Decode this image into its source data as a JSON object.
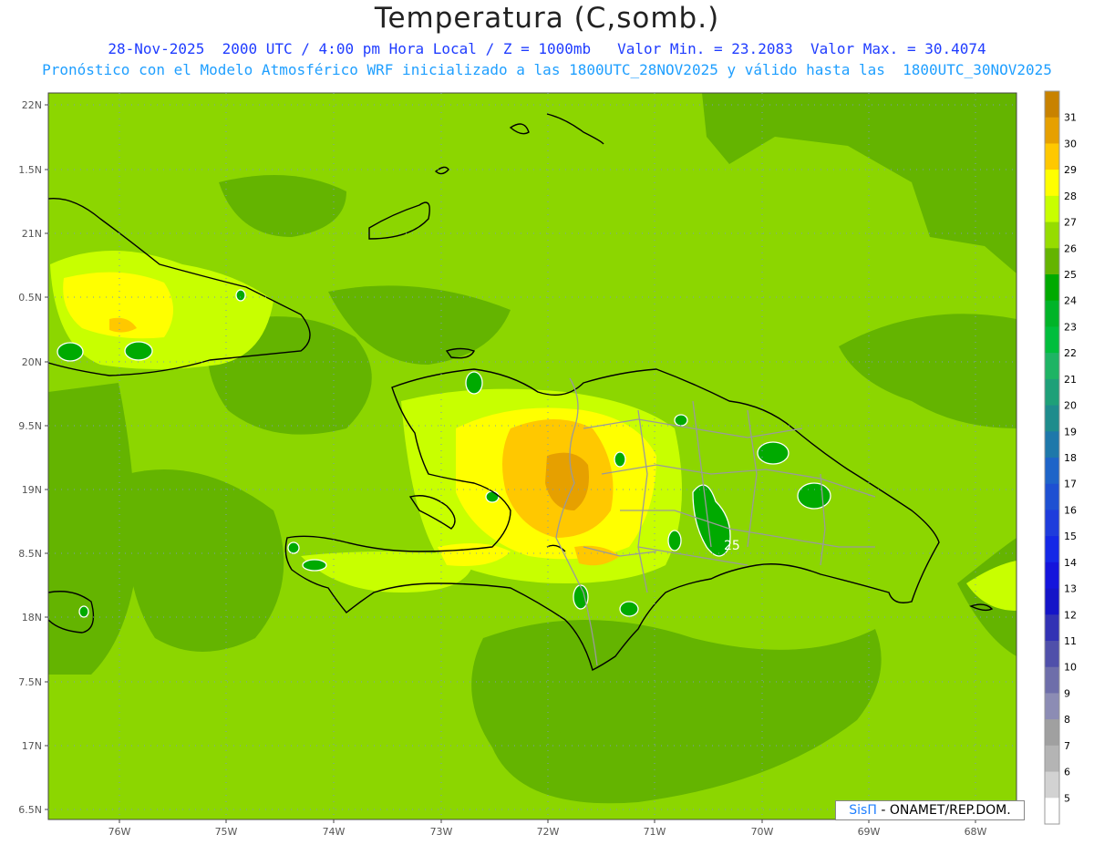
{
  "title": "Temperatura (C,somb.)",
  "subtitle_line1": "28-Nov-2025  2000 UTC / 4:00 pm Hora Local / Z = 1000mb   Valor Min. = 23.2083  Valor Max. = 30.4074",
  "subtitle_line2": "Pronóstico con el Modelo Atmosférico WRF inicializado a las 1800UTC_28NOV2025 y válido hasta las  1800UTC_30NOV2025",
  "credit": {
    "prefix": "SisΠ",
    "text": " - ONAMET/REP.DOM."
  },
  "chart_data": {
    "type": "heatmap",
    "variable": "Temperatura (C,somb.)",
    "min_value": 23.2083,
    "max_value": 30.4074,
    "x_axis": {
      "ticks": [
        "76W",
        "75W",
        "74W",
        "73W",
        "72W",
        "71W",
        "70W",
        "69W",
        "68W"
      ],
      "range": [
        -76.6,
        -67.6
      ]
    },
    "y_axis": {
      "ticks": [
        "22N",
        "1.5N",
        "21N",
        "0.5N",
        "20N",
        "9.5N",
        "19N",
        "8.5N",
        "18N",
        "7.5N",
        "17N",
        "6.5N"
      ],
      "range": [
        16.45,
        22.1
      ]
    },
    "contour_label": "25",
    "colorbar": {
      "labels": [
        "31",
        "30",
        "29",
        "28",
        "27",
        "26",
        "25",
        "24",
        "23",
        "22",
        "21",
        "20",
        "19",
        "18",
        "17",
        "16",
        "15",
        "14",
        "13",
        "12",
        "11",
        "10",
        "9",
        "8",
        "7",
        "6",
        "5"
      ],
      "colors": [
        "#c88200",
        "#e6a000",
        "#ffc800",
        "#ffff00",
        "#c8ff00",
        "#96dc00",
        "#64b400",
        "#00aa00",
        "#00b428",
        "#00be3c",
        "#1eb464",
        "#1ea078",
        "#1e8c8c",
        "#1e78aa",
        "#1e64c8",
        "#1e50d2",
        "#1e3cdc",
        "#1428e6",
        "#1414dc",
        "#1414c8",
        "#3232b4",
        "#5050aa",
        "#6e6eaa",
        "#8c8cb4",
        "#a0a0a0",
        "#b4b4b4",
        "#d2d2d2",
        "#ffffff"
      ]
    },
    "colors": {
      "background": "#8cd600",
      "cooler": "#64b400",
      "warm": "#c8ff00",
      "hot1": "#ffff00",
      "hot2": "#ffc800",
      "hot3": "#e6a000",
      "cold": "#00aa00",
      "border": "#000000",
      "provinces": "#999999"
    }
  }
}
